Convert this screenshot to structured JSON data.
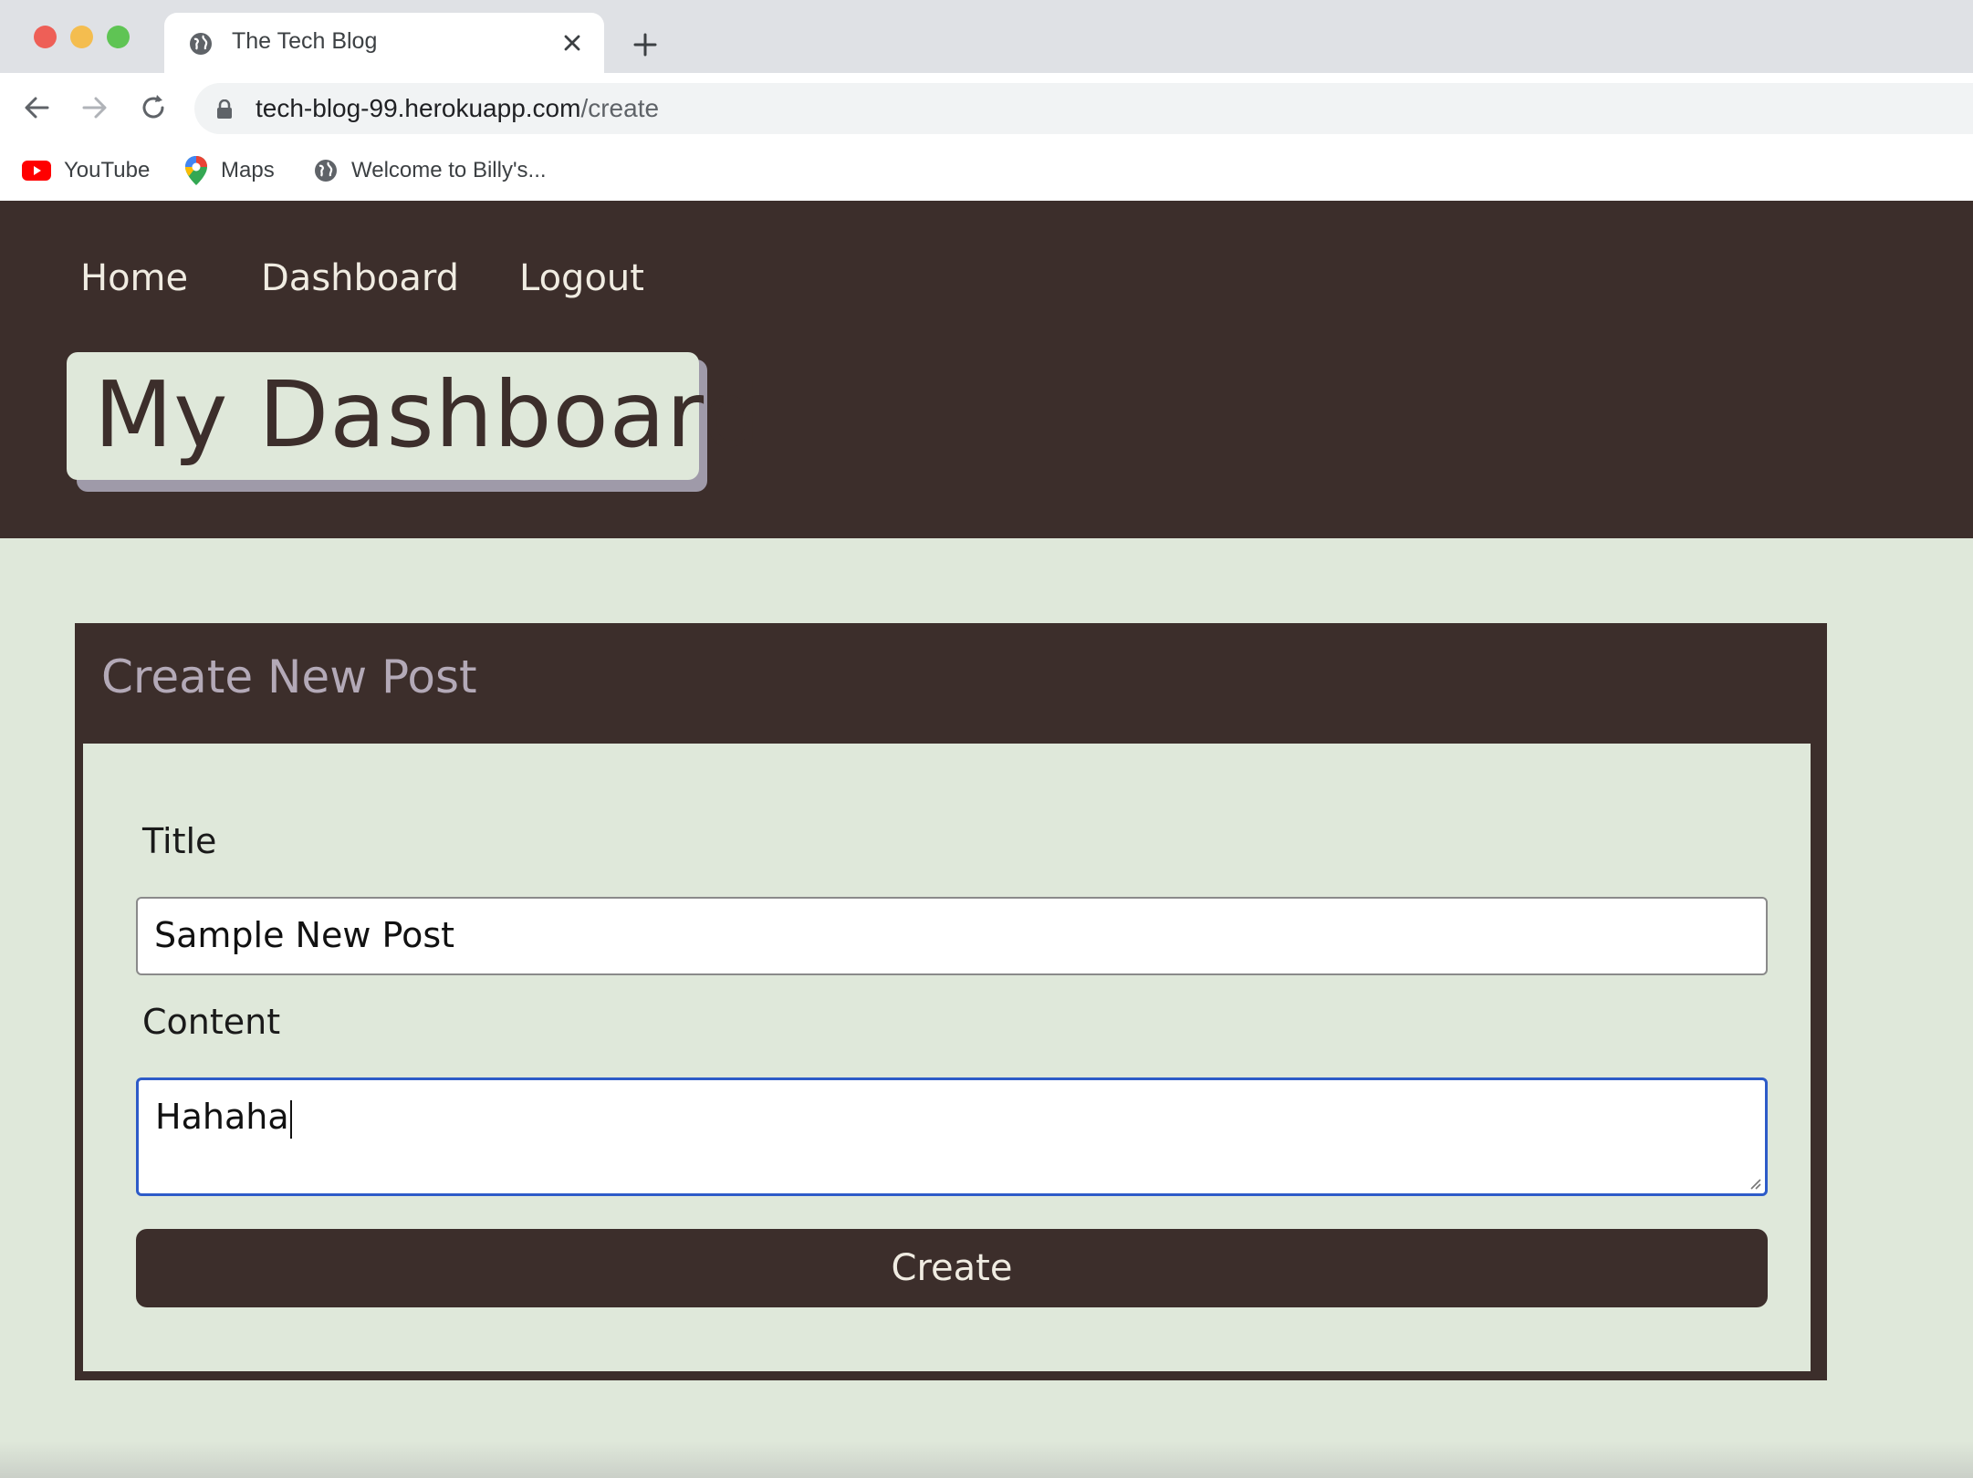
{
  "browser": {
    "tab_title": "The Tech Blog",
    "url_host": "tech-blog-99.herokuapp.com",
    "url_path": "/create",
    "bookmarks": [
      {
        "label": "YouTube",
        "icon": "youtube-icon"
      },
      {
        "label": "Maps",
        "icon": "maps-icon"
      },
      {
        "label": "Welcome to Billy's...",
        "icon": "globe-icon"
      }
    ]
  },
  "nav": {
    "links": [
      "Home",
      "Dashboard",
      "Logout"
    ]
  },
  "header": {
    "title": "My Dashboard"
  },
  "form": {
    "heading": "Create New Post",
    "title_label": "Title",
    "title_value": "Sample New Post",
    "content_label": "Content",
    "content_value": "Hahaha",
    "submit_label": "Create"
  },
  "colors": {
    "header_bg": "#3c2e2b",
    "page_bg": "#dfe8da",
    "nav_text": "#f0ece2",
    "card_title": "#b3a9b7",
    "focus_border": "#2d5bc8"
  }
}
